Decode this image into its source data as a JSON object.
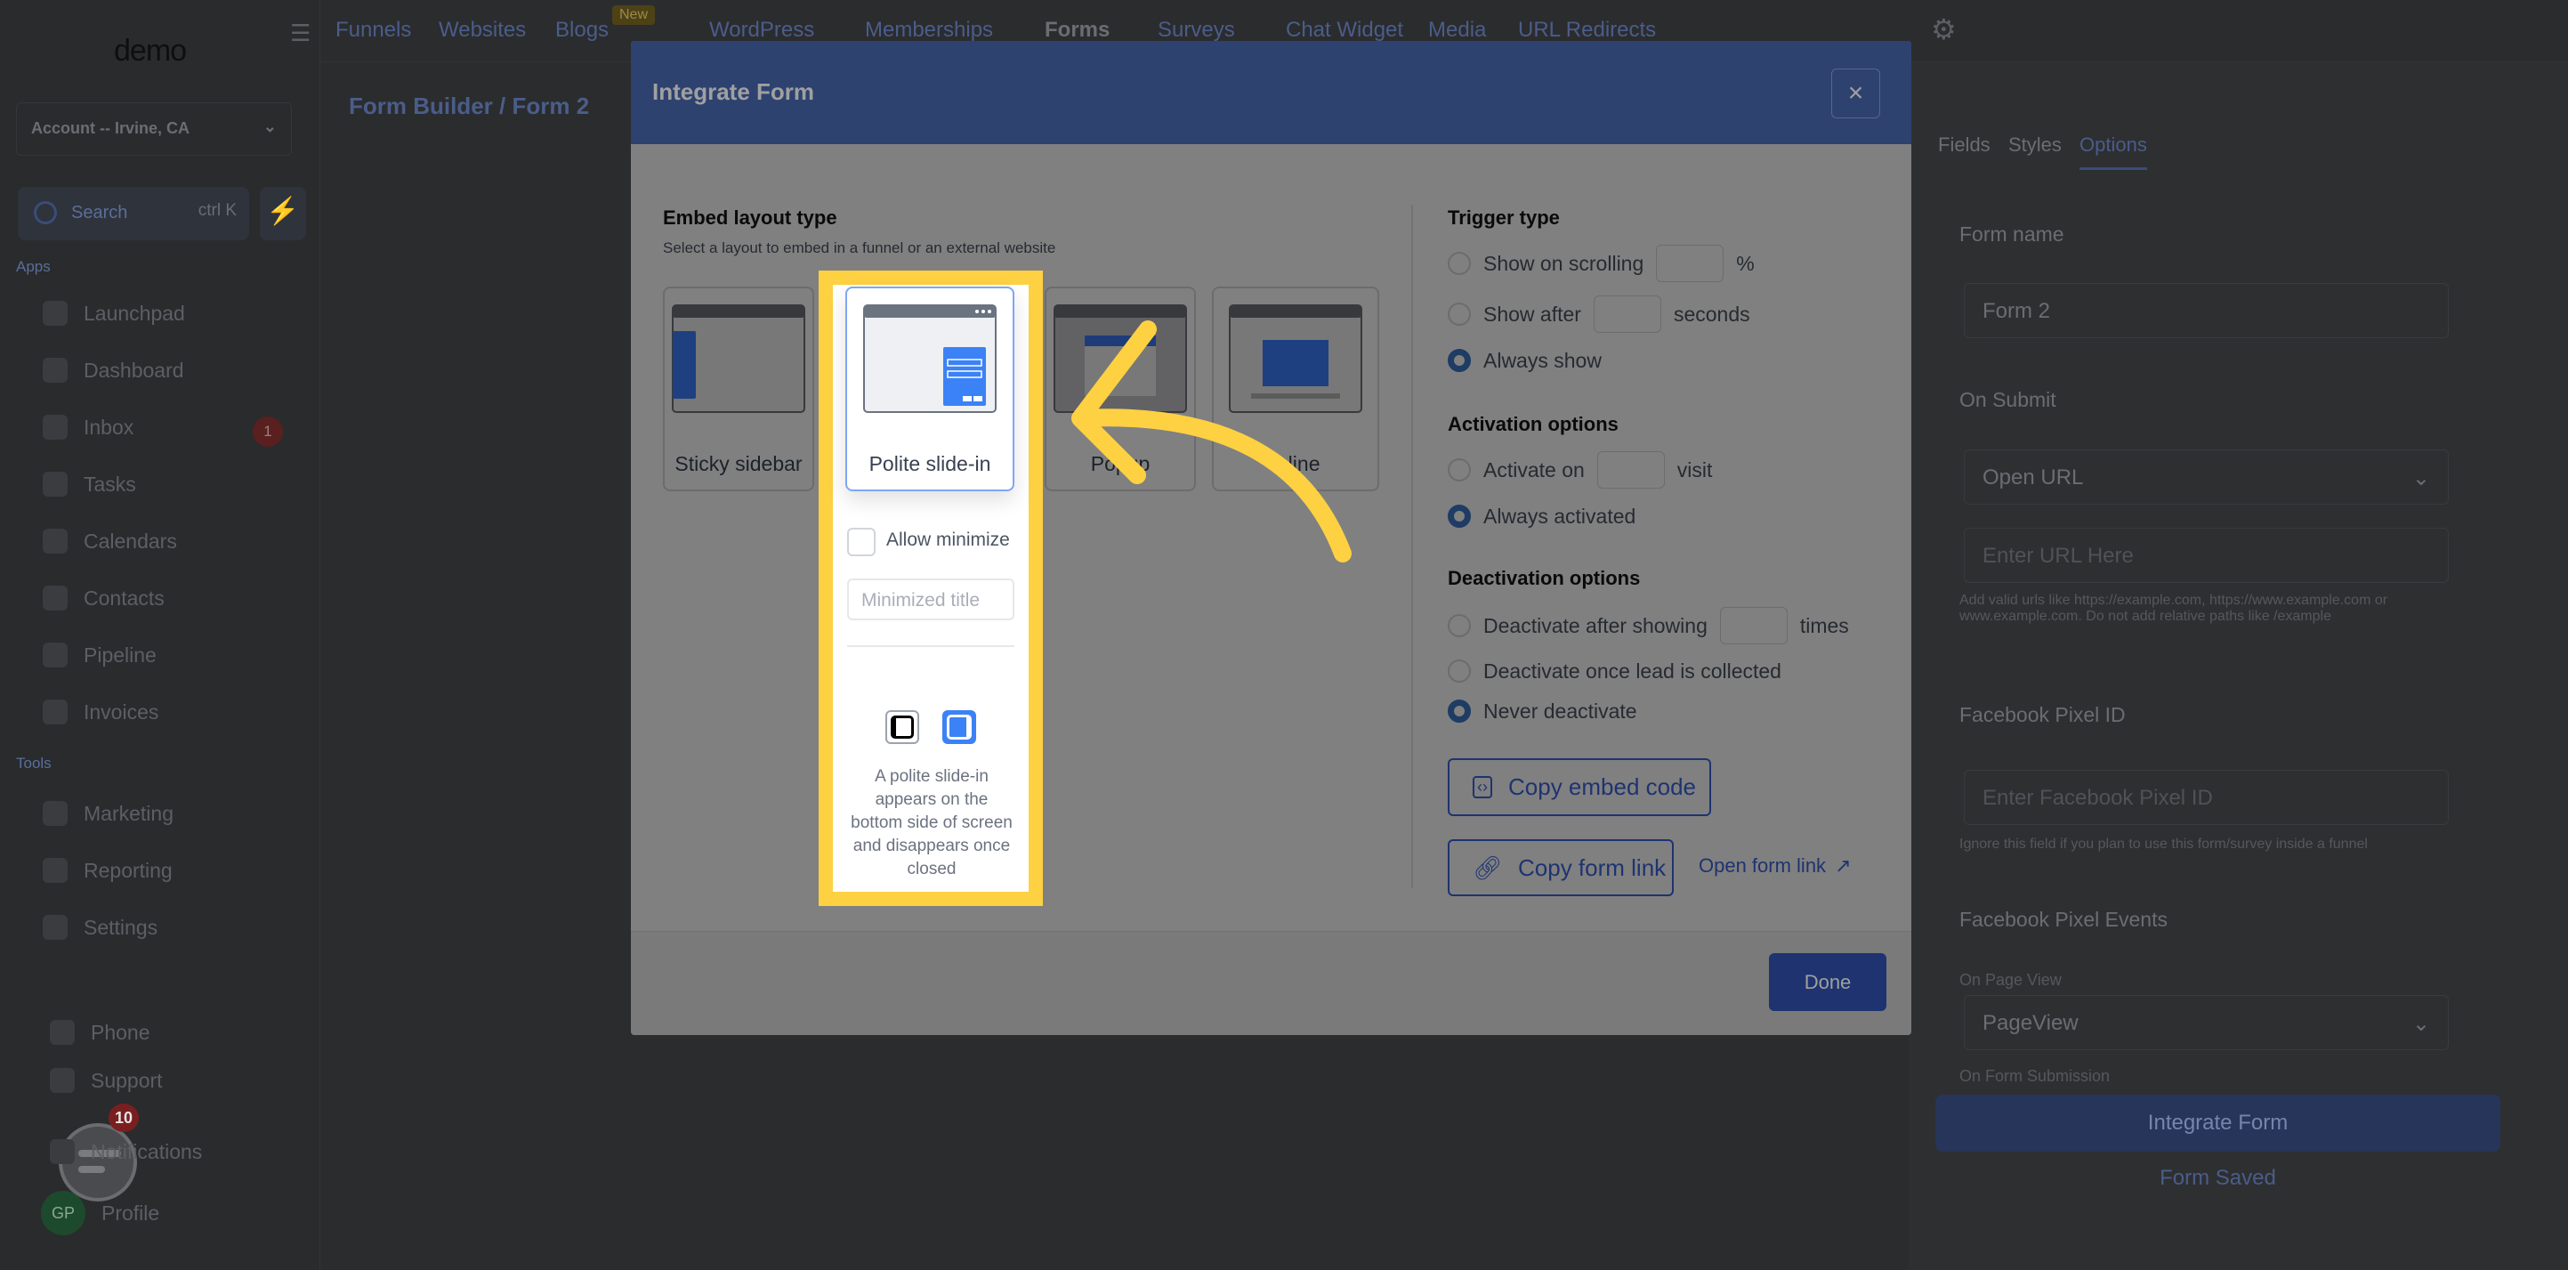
{
  "app": {
    "logo": "demo",
    "account": "Account -- Irvine, CA",
    "search": {
      "label": "Search",
      "shortcut": "ctrl K"
    },
    "sections": {
      "apps": "Apps",
      "tools": "Tools"
    },
    "sidebar": {
      "apps": [
        "Launchpad",
        "Dashboard",
        "Inbox",
        "Tasks",
        "Calendars",
        "Contacts",
        "Pipeline",
        "Invoices"
      ],
      "tools": [
        "Marketing",
        "Reporting",
        "Settings"
      ],
      "bottom": [
        "Phone",
        "Support",
        "Notifications",
        "Profile"
      ],
      "inbox_badge": "1",
      "avatar": "GP"
    },
    "chat_badge": "10",
    "topnav": {
      "items": [
        "Funnels",
        "Websites",
        "Blogs",
        "WordPress",
        "Memberships",
        "Forms",
        "Surveys",
        "Chat Widget",
        "Media",
        "URL Redirects"
      ],
      "new_badge": "New",
      "active": "Forms"
    },
    "breadcrumb": {
      "parent": "Form Builder /",
      "current": "Form 2"
    },
    "right_panel": {
      "tabs": [
        "Fields",
        "Styles",
        "Options"
      ],
      "active_tab": "Options",
      "form_name_label": "Form name",
      "form_name": "Form 2",
      "on_submit_label": "On Submit",
      "on_submit": "Open URL",
      "url_placeholder": "Enter URL Here",
      "url_help": "Add valid urls like https://example.com, https://www.example.com or www.example.com. Do not add relative paths like /example",
      "pixel_label": "Facebook Pixel ID",
      "pixel_placeholder": "Enter Facebook Pixel ID",
      "pixel_help": "Ignore this field if you plan to use this form/survey inside a funnel",
      "events_label": "Facebook Pixel Events",
      "page_view_label": "On Page View",
      "page_view": "PageView",
      "submission_label": "On Form Submission",
      "integrate_button": "Integrate Form",
      "saved": "Form Saved"
    }
  },
  "modal": {
    "title": "Integrate Form",
    "close": "×",
    "embed": {
      "title": "Embed layout type",
      "subtitle": "Select a layout to embed in a funnel or an external website",
      "layouts": [
        "Sticky sidebar",
        "Polite slide-in",
        "Popup",
        "Inline"
      ],
      "selected": "Polite slide-in",
      "allow_minimize": "Allow minimize",
      "allow_minimize_checked": false,
      "minimized_title_placeholder": "Minimized title",
      "position_selected": "right",
      "description": "A polite slide-in appears on the bottom side of screen and disappears once closed"
    },
    "trigger": {
      "title": "Trigger type",
      "show_on_scrolling": "Show on scrolling",
      "percent": "%",
      "show_after": "Show after",
      "seconds": "seconds",
      "always_show": "Always show",
      "selected": "Always show"
    },
    "activation": {
      "title": "Activation options",
      "activate_on": "Activate on",
      "visit": "visit",
      "always_activated": "Always activated",
      "selected": "Always activated"
    },
    "deactivation": {
      "title": "Deactivation options",
      "after_showing": "Deactivate after showing",
      "times": "times",
      "once_lead": "Deactivate once lead is collected",
      "never": "Never deactivate",
      "selected": "Never deactivate"
    },
    "copy_embed": "Copy embed code",
    "copy_link": "Copy form link",
    "open_link": "Open form link",
    "done": "Done"
  },
  "colors": {
    "accent": "#3b66d6",
    "highlight": "#fdd142",
    "header": "#5b83df"
  }
}
